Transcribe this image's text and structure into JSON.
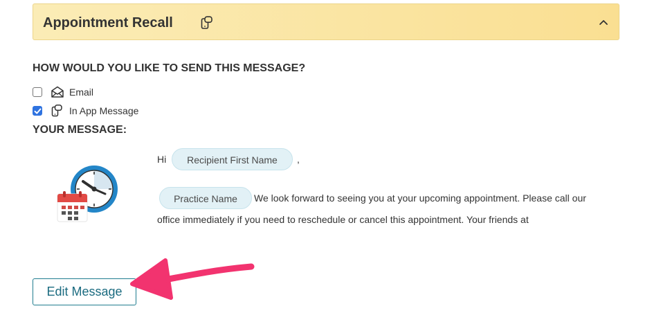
{
  "panel": {
    "title": "Appointment Recall",
    "collapse_icon": "chevron-up-icon",
    "message_icon": "in-app-message-icon",
    "header_colors": [
      "#fbecb6",
      "#fadf92"
    ]
  },
  "send_section": {
    "heading": "HOW WOULD YOU LIKE TO SEND THIS MESSAGE?",
    "options": [
      {
        "label": "Email",
        "icon": "envelope-open-icon",
        "checked": false
      },
      {
        "label": "In App Message",
        "icon": "in-app-message-icon",
        "checked": true
      }
    ]
  },
  "message_section": {
    "heading": "YOUR MESSAGE:",
    "illustration": "calendar-clock-icon",
    "greeting": "Hi",
    "recipient_token": "Recipient First Name",
    "comma": ",",
    "practice_token": "Practice Name",
    "body_line1": "We look forward to seeing you at your upcoming appointment. Please call our",
    "body_line2": "office immediately if you need to reschedule or cancel this appointment. Your friends at"
  },
  "actions": {
    "edit_label": "Edit Message",
    "accent_color": "#1f7c8f"
  },
  "annotation": {
    "arrow_color": "#f2336f"
  }
}
